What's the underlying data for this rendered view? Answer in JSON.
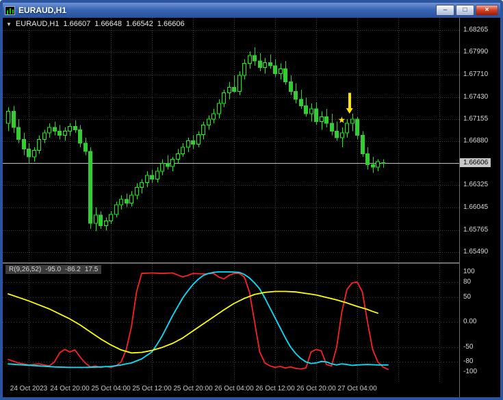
{
  "window": {
    "title": "EURAUD,H1",
    "minimize_glyph": "–",
    "maximize_glyph": "□",
    "close_glyph": "×"
  },
  "main_pane": {
    "collapse_glyph": "▼",
    "symbol": "EURAUD,H1",
    "open": "1.66607",
    "high": "1.66648",
    "low": "1.66542",
    "close": "1.66606"
  },
  "indicator_pane": {
    "name": "R(9,26,52)",
    "value1": "-95.0",
    "value2": "-86.2",
    "value3": "17.5"
  },
  "colors": {
    "background": "#000000",
    "grid": "#3f3f3f",
    "candle_up_border": "#00FF00",
    "candle_up_fill": "#000000",
    "candle_down_border": "#32CD32",
    "candle_down_fill": "#32CD32",
    "price_line": "#c0c0c0",
    "axis_text": "#d8d8d8",
    "current_price_bg": "#c8c8c8",
    "annotation": "#FFE400"
  },
  "chart_data": [
    {
      "type": "candlestick",
      "symbol": "EURAUD",
      "timeframe": "H1",
      "current_price": "1.66606",
      "price_max": 1.6842,
      "price_min": 1.6536,
      "y_axis_labels": [
        "1.68265",
        "1.67990",
        "1.67710",
        "1.67430",
        "1.67155",
        "1.66880",
        "1.66325",
        "1.66045",
        "1.65765",
        "1.65490"
      ],
      "x_labels": [
        "24 Oct 2023",
        "24 Oct 20:00",
        "25 Oct 04:00",
        "25 Oct 12:00",
        "25 Oct 20:00",
        "26 Oct 04:00",
        "26 Oct 12:00",
        "26 Oct 20:00",
        "27 Oct 04:00"
      ],
      "candles": [
        [
          1.671,
          1.673,
          1.67,
          1.6725
        ],
        [
          1.6725,
          1.6732,
          1.6698,
          1.6705
        ],
        [
          1.6705,
          1.6715,
          1.6685,
          1.669
        ],
        [
          1.669,
          1.6698,
          1.667,
          1.6678
        ],
        [
          1.6678,
          1.6685,
          1.666,
          1.6668
        ],
        [
          1.6668,
          1.668,
          1.6662,
          1.6676
        ],
        [
          1.6676,
          1.6695,
          1.6672,
          1.669
        ],
        [
          1.669,
          1.6702,
          1.6685,
          1.6698
        ],
        [
          1.6698,
          1.671,
          1.6692,
          1.6705
        ],
        [
          1.6705,
          1.6712,
          1.6695,
          1.67
        ],
        [
          1.67,
          1.6708,
          1.669,
          1.6695
        ],
        [
          1.6695,
          1.6705,
          1.6688,
          1.67
        ],
        [
          1.67,
          1.671,
          1.6694,
          1.6706
        ],
        [
          1.6706,
          1.6714,
          1.6698,
          1.6702
        ],
        [
          1.6702,
          1.6708,
          1.668,
          1.6685
        ],
        [
          1.6685,
          1.6692,
          1.667,
          1.6675
        ],
        [
          1.6675,
          1.668,
          1.6578,
          1.6585
        ],
        [
          1.6585,
          1.6605,
          1.6575,
          1.6595
        ],
        [
          1.6595,
          1.66,
          1.6578,
          1.6582
        ],
        [
          1.6582,
          1.6592,
          1.6576,
          1.6588
        ],
        [
          1.6588,
          1.66,
          1.6584,
          1.6596
        ],
        [
          1.6596,
          1.6612,
          1.6592,
          1.6608
        ],
        [
          1.6608,
          1.662,
          1.6602,
          1.6615
        ],
        [
          1.6615,
          1.6622,
          1.6605,
          1.661
        ],
        [
          1.661,
          1.6625,
          1.6606,
          1.662
        ],
        [
          1.662,
          1.6635,
          1.6615,
          1.663
        ],
        [
          1.663,
          1.664,
          1.6622,
          1.6636
        ],
        [
          1.6636,
          1.665,
          1.663,
          1.6645
        ],
        [
          1.6645,
          1.6652,
          1.6635,
          1.664
        ],
        [
          1.664,
          1.6655,
          1.6636,
          1.665
        ],
        [
          1.665,
          1.6665,
          1.6645,
          1.666
        ],
        [
          1.666,
          1.667,
          1.6652,
          1.6656
        ],
        [
          1.6656,
          1.6668,
          1.665,
          1.6665
        ],
        [
          1.6665,
          1.6678,
          1.666,
          1.6672
        ],
        [
          1.6672,
          1.6685,
          1.6668,
          1.668
        ],
        [
          1.668,
          1.6692,
          1.6674,
          1.6688
        ],
        [
          1.6688,
          1.6695,
          1.6678,
          1.6684
        ],
        [
          1.6684,
          1.67,
          1.668,
          1.6696
        ],
        [
          1.6696,
          1.6712,
          1.669,
          1.6708
        ],
        [
          1.6708,
          1.672,
          1.6702,
          1.6715
        ],
        [
          1.6715,
          1.6728,
          1.671,
          1.6722
        ],
        [
          1.6722,
          1.674,
          1.6716,
          1.6735
        ],
        [
          1.6735,
          1.6752,
          1.673,
          1.6748
        ],
        [
          1.6748,
          1.6762,
          1.674,
          1.6755
        ],
        [
          1.6755,
          1.677,
          1.6748,
          1.675
        ],
        [
          1.675,
          1.6775,
          1.6745,
          1.677
        ],
        [
          1.677,
          1.679,
          1.6765,
          1.6785
        ],
        [
          1.6785,
          1.68,
          1.6778,
          1.6795
        ],
        [
          1.6795,
          1.6805,
          1.6782,
          1.6788
        ],
        [
          1.6788,
          1.6798,
          1.6775,
          1.678
        ],
        [
          1.678,
          1.6792,
          1.6772,
          1.6786
        ],
        [
          1.6786,
          1.6796,
          1.6778,
          1.6782
        ],
        [
          1.6782,
          1.679,
          1.6768,
          1.6772
        ],
        [
          1.6772,
          1.6785,
          1.6765,
          1.6778
        ],
        [
          1.6778,
          1.6788,
          1.6758,
          1.6762
        ],
        [
          1.6762,
          1.677,
          1.6745,
          1.675
        ],
        [
          1.675,
          1.676,
          1.6735,
          1.674
        ],
        [
          1.674,
          1.6752,
          1.6728,
          1.6732
        ],
        [
          1.6732,
          1.6742,
          1.6718,
          1.6722
        ],
        [
          1.6722,
          1.6735,
          1.6712,
          1.6728
        ],
        [
          1.6728,
          1.6736,
          1.6708,
          1.6712
        ],
        [
          1.6712,
          1.6725,
          1.6702,
          1.6718
        ],
        [
          1.6718,
          1.6728,
          1.6705,
          1.671
        ],
        [
          1.671,
          1.6722,
          1.6695,
          1.67
        ],
        [
          1.67,
          1.6712,
          1.6688,
          1.6692
        ],
        [
          1.6692,
          1.6705,
          1.668,
          1.6698
        ],
        [
          1.6698,
          1.6715,
          1.6692,
          1.671
        ],
        [
          1.671,
          1.6722,
          1.67,
          1.6715
        ],
        [
          1.6715,
          1.6718,
          1.669,
          1.6695
        ],
        [
          1.6695,
          1.67,
          1.6668,
          1.6672
        ],
        [
          1.6672,
          1.668,
          1.6652,
          1.6658
        ],
        [
          1.6658,
          1.6668,
          1.6648,
          1.6655
        ],
        [
          1.6655,
          1.6665,
          1.665,
          1.6662
        ],
        [
          1.66607,
          1.66648,
          1.66542,
          1.66606
        ]
      ],
      "annotations": [
        {
          "type": "arrow-down",
          "name": "yellow-down-arrow",
          "x_index": 66.5,
          "tip_price": 1.6722,
          "tail_price": 1.6748,
          "color": "#FFE400"
        },
        {
          "type": "star",
          "name": "yellow-star",
          "x_index": 65.0,
          "price": 1.6714,
          "color": "#FFE400"
        }
      ]
    },
    {
      "type": "line",
      "title": "R(9,26,52)",
      "current_values": [
        -95.0,
        -86.2,
        17.5
      ],
      "y_range": [
        -100,
        100
      ],
      "y_axis_labels": [
        "100",
        "80",
        "50",
        "0.00",
        "-50",
        "-80",
        "-100"
      ],
      "level_lines": [
        80,
        50,
        0,
        -50,
        -80
      ],
      "series": [
        {
          "name": "red",
          "color": "#FF2020",
          "points": [
            [
              0,
              -75
            ],
            [
              2,
              -82
            ],
            [
              4,
              -86
            ],
            [
              6,
              -84
            ],
            [
              8,
              -88
            ],
            [
              9,
              -80
            ],
            [
              10,
              -62
            ],
            [
              11,
              -55
            ],
            [
              12,
              -60
            ],
            [
              13,
              -56
            ],
            [
              14,
              -70
            ],
            [
              15,
              -82
            ],
            [
              16,
              -90
            ],
            [
              17,
              -88
            ],
            [
              18,
              -91
            ],
            [
              19,
              -89
            ],
            [
              20,
              -91
            ],
            [
              21,
              -88
            ],
            [
              22,
              -80
            ],
            [
              23,
              -55
            ],
            [
              24,
              -10
            ],
            [
              25,
              60
            ],
            [
              26,
              97
            ],
            [
              28,
              98
            ],
            [
              30,
              97
            ],
            [
              32,
              98
            ],
            [
              34,
              90
            ],
            [
              35,
              93
            ],
            [
              36,
              97
            ],
            [
              38,
              96
            ],
            [
              40,
              97
            ],
            [
              41,
              90
            ],
            [
              42,
              86
            ],
            [
              43,
              93
            ],
            [
              44,
              97
            ],
            [
              45,
              97
            ],
            [
              46,
              90
            ],
            [
              47,
              60
            ],
            [
              48,
              0
            ],
            [
              49,
              -60
            ],
            [
              50,
              -82
            ],
            [
              51,
              -88
            ],
            [
              52,
              -91
            ],
            [
              53,
              -89
            ],
            [
              54,
              -92
            ],
            [
              55,
              -90
            ],
            [
              56,
              -93
            ],
            [
              57,
              -94
            ],
            [
              58,
              -92
            ],
            [
              59,
              -60
            ],
            [
              60,
              -55
            ],
            [
              61,
              -58
            ],
            [
              62,
              -85
            ],
            [
              63,
              -88
            ],
            [
              64,
              -50
            ],
            [
              65,
              20
            ],
            [
              66,
              65
            ],
            [
              67,
              78
            ],
            [
              68,
              80
            ],
            [
              69,
              60
            ],
            [
              70,
              0
            ],
            [
              71,
              -55
            ],
            [
              72,
              -80
            ],
            [
              73,
              -90
            ],
            [
              74,
              -95
            ]
          ]
        },
        {
          "name": "cyan",
          "color": "#00E5FF",
          "points": [
            [
              0,
              -84
            ],
            [
              3,
              -86
            ],
            [
              6,
              -88
            ],
            [
              9,
              -90
            ],
            [
              12,
              -91
            ],
            [
              15,
              -91
            ],
            [
              18,
              -90
            ],
            [
              20,
              -89
            ],
            [
              22,
              -86
            ],
            [
              24,
              -82
            ],
            [
              26,
              -74
            ],
            [
              28,
              -60
            ],
            [
              29,
              -45
            ],
            [
              30,
              -28
            ],
            [
              31,
              -8
            ],
            [
              32,
              12
            ],
            [
              33,
              30
            ],
            [
              34,
              48
            ],
            [
              35,
              62
            ],
            [
              36,
              75
            ],
            [
              37,
              85
            ],
            [
              38,
              93
            ],
            [
              39,
              97
            ],
            [
              40,
              99
            ],
            [
              41,
              100
            ],
            [
              43,
              100
            ],
            [
              45,
              99
            ],
            [
              46,
              95
            ],
            [
              47,
              88
            ],
            [
              48,
              78
            ],
            [
              49,
              66
            ],
            [
              50,
              48
            ],
            [
              51,
              28
            ],
            [
              52,
              8
            ],
            [
              53,
              -12
            ],
            [
              54,
              -32
            ],
            [
              55,
              -50
            ],
            [
              56,
              -63
            ],
            [
              57,
              -73
            ],
            [
              58,
              -80
            ],
            [
              59,
              -83
            ],
            [
              60,
              -82
            ],
            [
              61,
              -79
            ],
            [
              62,
              -80
            ],
            [
              63,
              -84
            ],
            [
              64,
              -86
            ],
            [
              65,
              -84
            ],
            [
              66,
              -85
            ],
            [
              67,
              -87
            ],
            [
              68,
              -86
            ],
            [
              70,
              -85
            ],
            [
              72,
              -86
            ],
            [
              74,
              -86
            ]
          ]
        },
        {
          "name": "yellow",
          "color": "#FFFF00",
          "points": [
            [
              0,
              56
            ],
            [
              2,
              49
            ],
            [
              4,
              42
            ],
            [
              6,
              34
            ],
            [
              8,
              26
            ],
            [
              10,
              16
            ],
            [
              12,
              6
            ],
            [
              14,
              -6
            ],
            [
              16,
              -20
            ],
            [
              18,
              -34
            ],
            [
              20,
              -46
            ],
            [
              22,
              -56
            ],
            [
              24,
              -62
            ],
            [
              26,
              -61
            ],
            [
              28,
              -57
            ],
            [
              30,
              -51
            ],
            [
              32,
              -43
            ],
            [
              34,
              -32
            ],
            [
              36,
              -18
            ],
            [
              38,
              -4
            ],
            [
              40,
              10
            ],
            [
              42,
              24
            ],
            [
              44,
              37
            ],
            [
              46,
              47
            ],
            [
              48,
              55
            ],
            [
              50,
              59
            ],
            [
              52,
              61
            ],
            [
              54,
              61
            ],
            [
              56,
              60
            ],
            [
              58,
              57
            ],
            [
              60,
              54
            ],
            [
              62,
              49
            ],
            [
              64,
              44
            ],
            [
              66,
              38
            ],
            [
              68,
              31
            ],
            [
              70,
              25
            ],
            [
              71,
              21
            ],
            [
              72,
              17.5
            ]
          ]
        }
      ]
    }
  ]
}
